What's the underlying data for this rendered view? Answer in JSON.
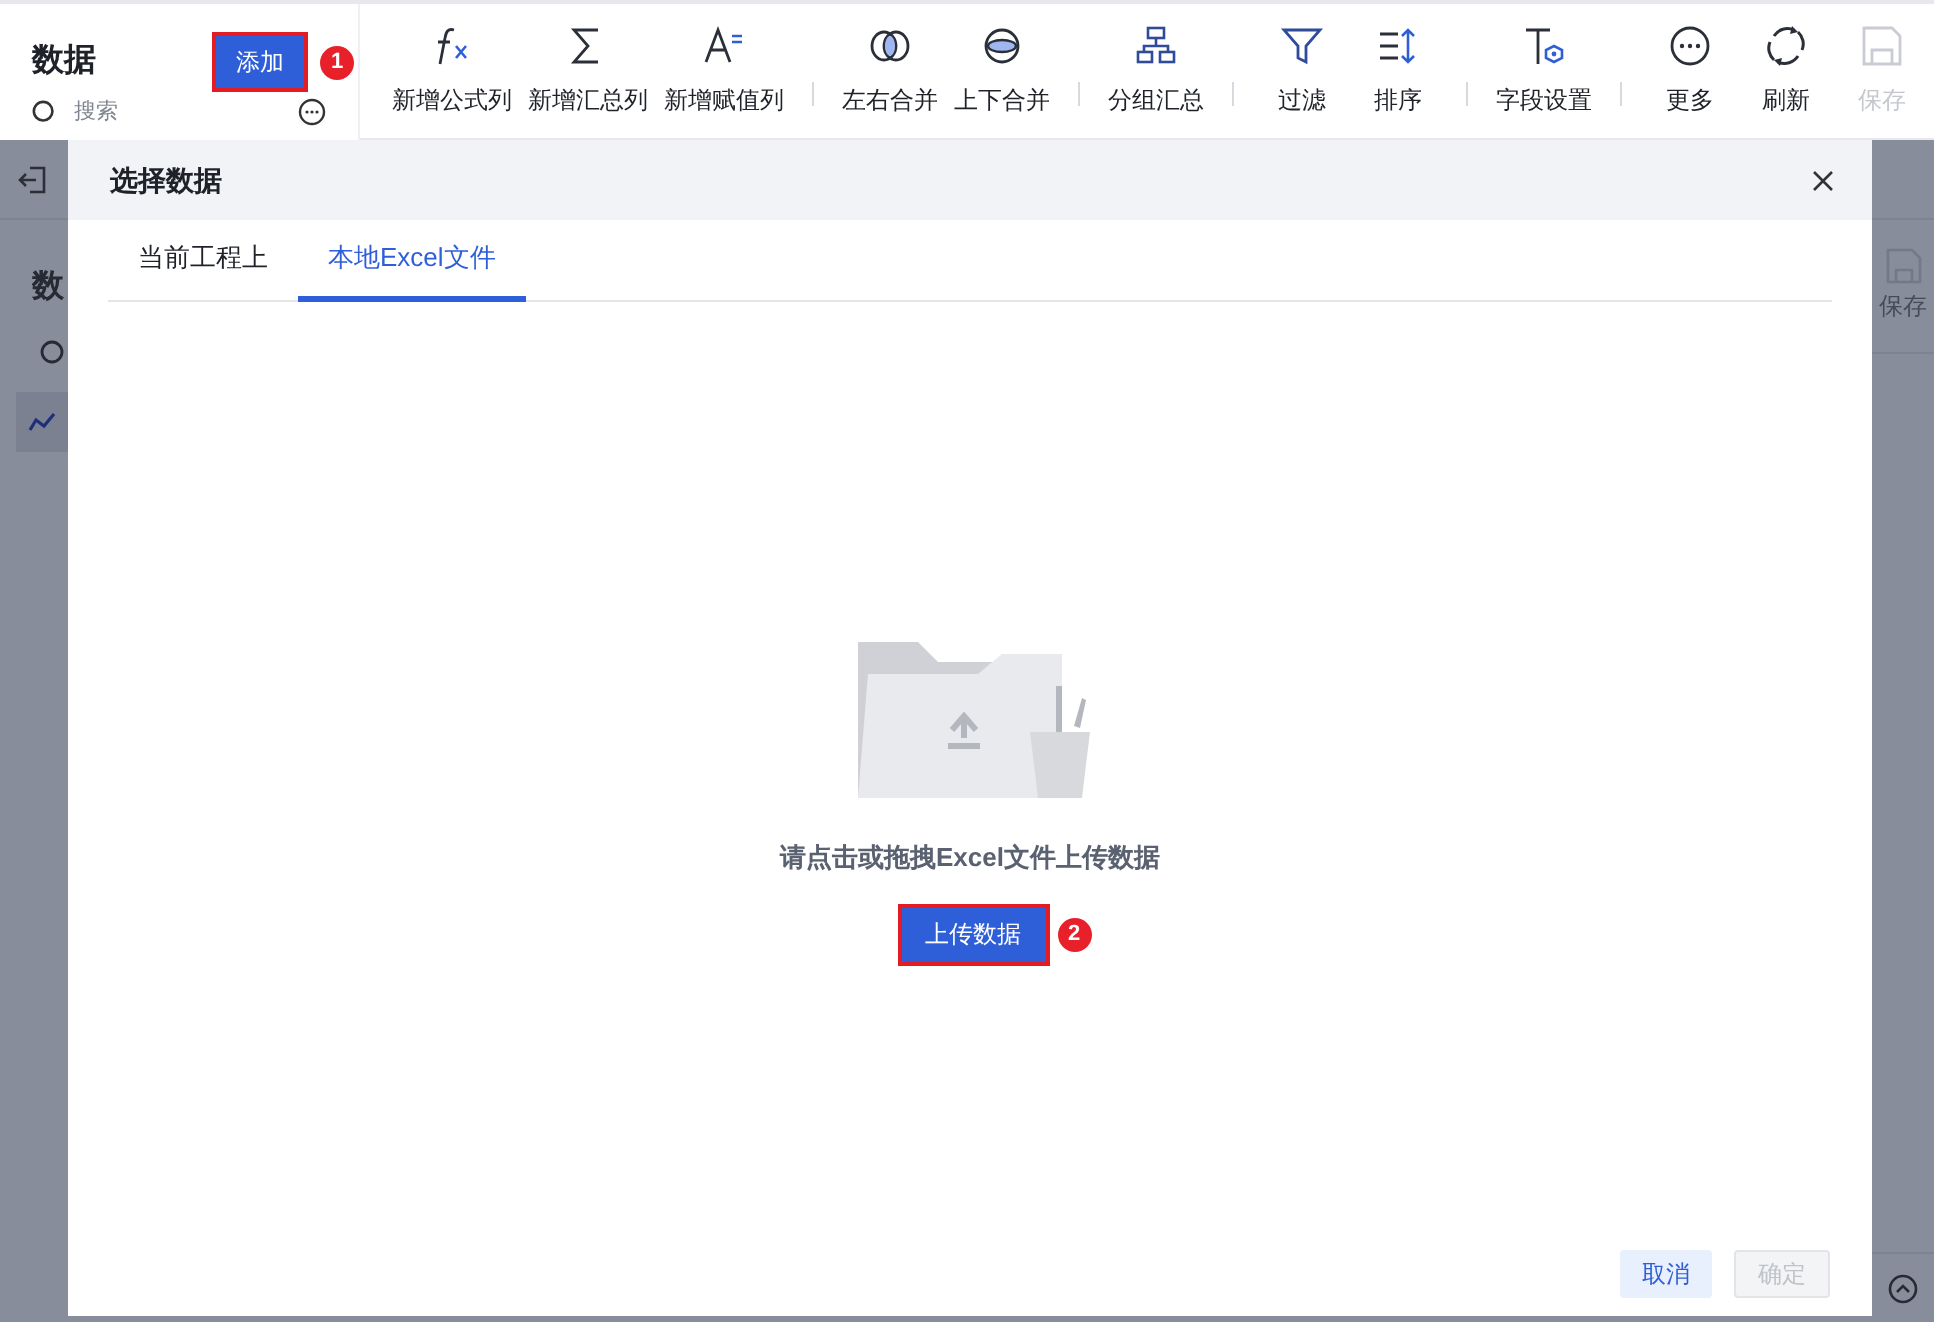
{
  "left_panel": {
    "title": "数据",
    "add_button": {
      "label": "添加",
      "highlighted": true,
      "step": "1"
    },
    "search": {
      "placeholder": "搜索"
    }
  },
  "toolbar": {
    "groups": [
      [
        {
          "kind": "formula",
          "label": "新增公式列",
          "disabled": false
        },
        {
          "kind": "sum",
          "label": "新增汇总列",
          "disabled": false
        },
        {
          "kind": "assign",
          "label": "新增赋值列",
          "disabled": false
        }
      ],
      [
        {
          "kind": "merge-lr",
          "label": "左右合并",
          "disabled": false
        },
        {
          "kind": "merge-tb",
          "label": "上下合并",
          "disabled": false
        }
      ],
      [
        {
          "kind": "group",
          "label": "分组汇总",
          "disabled": false
        }
      ],
      [
        {
          "kind": "filter",
          "label": "过滤",
          "disabled": false
        },
        {
          "kind": "sort",
          "label": "排序",
          "disabled": false
        }
      ],
      [
        {
          "kind": "field",
          "label": "字段设置",
          "disabled": false
        }
      ],
      [
        {
          "kind": "more",
          "label": "更多",
          "disabled": false
        },
        {
          "kind": "refresh",
          "label": "刷新",
          "disabled": false
        },
        {
          "kind": "save",
          "label": "保存",
          "disabled": true
        }
      ]
    ]
  },
  "background_page": {
    "title": "数",
    "save_label": "保存"
  },
  "dialog": {
    "title": "选择数据",
    "tabs": [
      {
        "label": "当前工程上",
        "selected": false
      },
      {
        "label": "本地Excel文件",
        "selected": true
      }
    ],
    "upload": {
      "hint": "请点击或拖拽Excel文件上传数据",
      "button": {
        "label": "上传数据",
        "highlighted": true,
        "step": "2"
      }
    },
    "footer_buttons": [
      {
        "label": "取消",
        "disabled": false
      },
      {
        "label": "确定",
        "disabled": true
      }
    ]
  }
}
